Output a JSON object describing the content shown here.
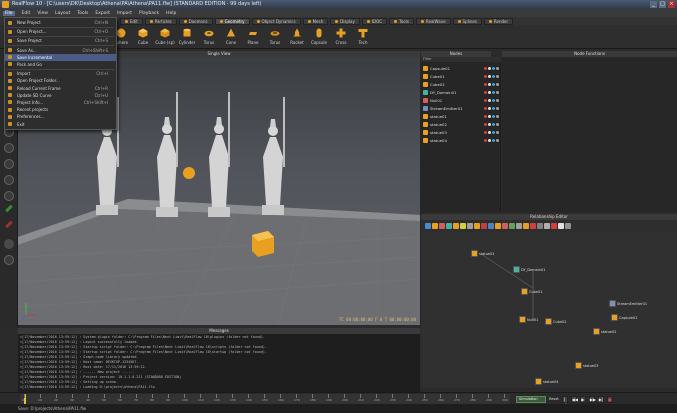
{
  "window": {
    "title": "RealFlow 10 · [C:\\users\\DK\\Desktop\\Athena\\PA\\Athena\\PA11.flw] (STANDARD EDITION · 99 days left)",
    "buttons": [
      "_",
      "□",
      "×"
    ]
  },
  "menubar": [
    "File",
    "Edit",
    "View",
    "Layout",
    "Tools",
    "Export",
    "Import",
    "Playback",
    "Help"
  ],
  "tabs": [
    {
      "label": "Edit",
      "active": false
    },
    {
      "label": "Particles",
      "active": false
    },
    {
      "label": "Daemons",
      "active": false
    },
    {
      "label": "Geometry",
      "active": true
    },
    {
      "label": "Object Dynamics",
      "active": false
    },
    {
      "label": "Mesh",
      "active": false
    },
    {
      "label": "Display",
      "active": false
    },
    {
      "label": "IDOC",
      "active": false
    },
    {
      "label": "Tools",
      "active": false
    },
    {
      "label": "RealWave",
      "active": false
    },
    {
      "label": "Splines",
      "active": false
    },
    {
      "label": "Render",
      "active": false
    }
  ],
  "toolbar": [
    {
      "label": "Sphere",
      "icon": "sphere-icon"
    },
    {
      "label": "Cube",
      "icon": "cube-icon"
    },
    {
      "label": "Cube (sp)",
      "icon": "cube-icon"
    },
    {
      "label": "Cylinder",
      "icon": "cylinder-icon"
    },
    {
      "label": "Torus",
      "icon": "torus-icon"
    },
    {
      "label": "Cone",
      "icon": "cone-icon"
    },
    {
      "label": "Plane",
      "icon": "plane-icon"
    },
    {
      "label": "Torus",
      "icon": "torus-icon"
    },
    {
      "label": "Rocket",
      "icon": "rocket-icon"
    },
    {
      "label": "Capsule",
      "icon": "capsule-icon"
    },
    {
      "label": "Cross",
      "icon": "cross-icon"
    },
    {
      "label": "Tech",
      "icon": "tech-icon"
    }
  ],
  "filemenu": [
    {
      "label": "New Project",
      "shortcut": "Ctrl+N",
      "highlight": false
    },
    {
      "sep": true
    },
    {
      "label": "Open Project...",
      "shortcut": "Ctrl+O",
      "highlight": false
    },
    {
      "sep": true
    },
    {
      "label": "Save Project",
      "shortcut": "Ctrl+S",
      "highlight": false
    },
    {
      "sep": true
    },
    {
      "label": "Save As...",
      "shortcut": "Ctrl+Shift+S",
      "highlight": false
    },
    {
      "label": "Save Incremental",
      "shortcut": "",
      "highlight": true
    },
    {
      "label": "Pack and Go",
      "shortcut": "",
      "highlight": false
    },
    {
      "sep": true
    },
    {
      "label": "Import",
      "shortcut": "Ctrl+I",
      "highlight": false
    },
    {
      "label": "Open Project Folder...",
      "shortcut": "",
      "highlight": false
    },
    {
      "label": "Reload Current Frame",
      "shortcut": "Ctrl+R",
      "highlight": false
    },
    {
      "label": "Update SD Curve",
      "shortcut": "Ctrl+U",
      "highlight": false
    },
    {
      "label": "Project Info...",
      "shortcut": "Ctrl+Shift+I",
      "highlight": false
    },
    {
      "label": "Recent projects",
      "shortcut": "",
      "highlight": false
    },
    {
      "label": "Preferences...",
      "shortcut": "",
      "highlight": false
    },
    {
      "label": "Exit",
      "shortcut": "",
      "highlight": false
    }
  ],
  "viewport": {
    "title": "Single View",
    "status": "TC 00:00:00:00   F 0   T 00:00:00:00"
  },
  "nodes": {
    "title": "Nodes",
    "filter": "Filter",
    "items": [
      {
        "name": "Capsule01",
        "color": "#e8a020"
      },
      {
        "name": "Cube01",
        "color": "#e8a020"
      },
      {
        "name": "Cube02",
        "color": "#e8a020"
      },
      {
        "name": "DY_Domain01",
        "color": "#4ab0a0"
      },
      {
        "name": "Null01",
        "color": "#d06060"
      },
      {
        "name": "StreamEmitter01",
        "color": "#7090c0"
      },
      {
        "name": "statue01",
        "color": "#e8a020"
      },
      {
        "name": "statue02",
        "color": "#e8a020"
      },
      {
        "name": "statue03",
        "color": "#e8a020"
      },
      {
        "name": "statue04",
        "color": "#e8a020"
      }
    ]
  },
  "nodeFunctions": {
    "title": "Node Functions"
  },
  "relationship": {
    "title": "Relationship Editor",
    "nodes": [
      {
        "name": "statue01",
        "color": "#e8a020"
      },
      {
        "name": "DY_Domain01",
        "color": "#4ab0a0"
      },
      {
        "name": "Cube01",
        "color": "#e8a020"
      },
      {
        "name": "StreamEmitter01",
        "color": "#8090b0"
      },
      {
        "name": "Null01",
        "color": "#e8a020"
      },
      {
        "name": "Cube02",
        "color": "#e8a020"
      },
      {
        "name": "Capsule01",
        "color": "#e8a020"
      },
      {
        "name": "statue02",
        "color": "#e8a020"
      },
      {
        "name": "statue03",
        "color": "#e8a020"
      },
      {
        "name": "statue04",
        "color": "#e8a020"
      }
    ]
  },
  "messages": {
    "title": "Messages",
    "lines": [
      ">[17/November/2016 13:59:12] : System plugin folder: C:\\Program Files\\Next Limit\\RealFlow 10\\plugins (folder not found).",
      ">[17/November/2016 13:59:12] : Layout successfully loaded.",
      ">[17/November/2016 13:59:12] : Startup script folder: C:\\Program Files\\Next Limit\\RealFlow 10\\scripts (folder not found).",
      ">[17/November/2016 13:59:12] : Startup script folder: C:\\Program Files\\Next Limit\\RealFlow 10\\startup (folder not found).",
      ">[17/November/2016 13:59:12] : Graph node library updated.",
      ">[17/November/2016 13:59:12] : Host name: DESKTOP-1234567.",
      ">[17/November/2016 13:59:12] : Host date: 17/11/2016 13:59:12.",
      ">[17/November/2016 13:59:12] : ------ New project ------",
      ">[17/November/2016 13:59:12] : Project version: 10.1.1.0.211 (STANDARD EDITION)",
      ">[17/November/2016 13:59:12] : Getting up scene.",
      ">[17/November/2016 13:59:12] : Loading D:\\projects\\Athena\\PA11.flw",
      ">[17/November/2016 13:59:13] : Saved: D:\\projects\\Athena\\PA11.flw"
    ]
  },
  "timeline": {
    "ticks": [
      "0",
      "10",
      "20",
      "30",
      "40",
      "50",
      "60",
      "70",
      "80",
      "90",
      "100",
      "110",
      "120",
      "130",
      "140",
      "150",
      "160",
      "170",
      "180",
      "190",
      "200",
      "210",
      "220",
      "230",
      "240",
      "250",
      "260",
      "270",
      "280",
      "290",
      "300"
    ],
    "cursor_frame": 0,
    "mode": "Simulation",
    "reset": "Reset",
    "buttons": [
      "|◀",
      "◀◀",
      "▶",
      "▶▶",
      "▶|",
      "●"
    ]
  },
  "statusbar": {
    "text": "Save: D:\\projects\\Athena\\PA11.flw"
  }
}
